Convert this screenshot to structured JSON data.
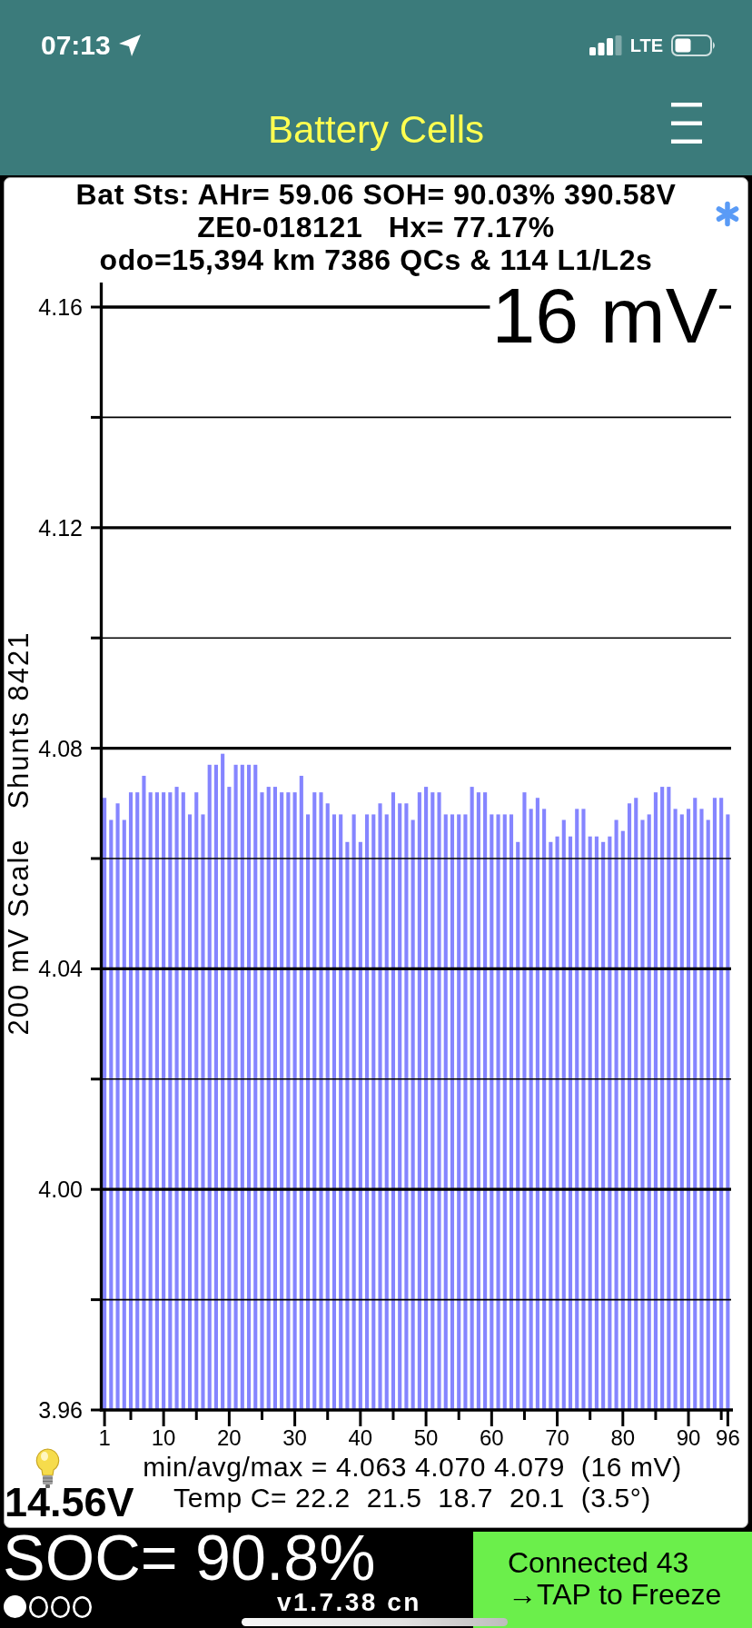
{
  "status_bar": {
    "time": "07:13",
    "network": "LTE"
  },
  "nav_bar": {
    "title": "Battery Cells"
  },
  "summary": {
    "lines": [
      "Bat Sts: AHr= 59.06 SOH= 90.03% 390.58V",
      "ZE0-018121   Hx= 77.17%",
      "odo=15,394 km 7386 QCs & 114 L1/L2s"
    ]
  },
  "cell_chart": {
    "spread": "16 mV",
    "chart_data": {
      "type": "bar",
      "ylabel": "200 mV Scale   Shunts 8421",
      "grid": true,
      "x": [
        1,
        2,
        3,
        4,
        5,
        6,
        7,
        8,
        9,
        10,
        11,
        12,
        13,
        14,
        15,
        16,
        17,
        18,
        19,
        20,
        21,
        22,
        23,
        24,
        25,
        26,
        27,
        28,
        29,
        30,
        31,
        32,
        33,
        34,
        35,
        36,
        37,
        38,
        39,
        40,
        41,
        42,
        43,
        44,
        45,
        46,
        47,
        48,
        49,
        50,
        51,
        52,
        53,
        54,
        55,
        56,
        57,
        58,
        59,
        60,
        61,
        62,
        63,
        64,
        65,
        66,
        67,
        68,
        69,
        70,
        71,
        72,
        73,
        74,
        75,
        76,
        77,
        78,
        79,
        80,
        81,
        82,
        83,
        84,
        85,
        86,
        87,
        88,
        89,
        90,
        91,
        92,
        93,
        94,
        95,
        96
      ],
      "values": [
        4.071,
        4.067,
        4.07,
        4.067,
        4.072,
        4.072,
        4.075,
        4.072,
        4.072,
        4.072,
        4.072,
        4.073,
        4.072,
        4.068,
        4.072,
        4.068,
        4.077,
        4.077,
        4.079,
        4.073,
        4.077,
        4.077,
        4.077,
        4.077,
        4.072,
        4.073,
        4.073,
        4.072,
        4.072,
        4.072,
        4.075,
        4.068,
        4.072,
        4.072,
        4.07,
        4.068,
        4.068,
        4.063,
        4.068,
        4.063,
        4.068,
        4.068,
        4.07,
        4.068,
        4.072,
        4.07,
        4.07,
        4.067,
        4.072,
        4.073,
        4.072,
        4.072,
        4.068,
        4.068,
        4.068,
        4.068,
        4.073,
        4.072,
        4.072,
        4.068,
        4.068,
        4.068,
        4.068,
        4.063,
        4.072,
        4.069,
        4.071,
        4.069,
        4.063,
        4.064,
        4.067,
        4.064,
        4.069,
        4.069,
        4.064,
        4.064,
        4.063,
        4.064,
        4.067,
        4.065,
        4.07,
        4.071,
        4.067,
        4.068,
        4.072,
        4.073,
        4.073,
        4.069,
        4.068,
        4.069,
        4.071,
        4.069,
        4.067,
        4.071,
        4.071,
        4.068
      ],
      "xlim": [
        0.5,
        96.5
      ],
      "ylim": [
        3.96,
        4.16
      ],
      "xticks": [
        1,
        10,
        20,
        30,
        40,
        50,
        60,
        70,
        80,
        90,
        96
      ],
      "yticks": [
        3.96,
        {
          "value": 4.0,
          "label": "4.00"
        },
        4.04,
        4.08,
        4.12,
        4.16
      ]
    }
  },
  "stats": {
    "min_avg_max": "min/avg/max = 4.063 4.070 4.079  (16 mV)",
    "temperatures": "Temp C= 22.2  21.5  18.7  20.1  (3.5°)",
    "aux_voltage": "14.56V"
  },
  "footer": {
    "soc": "SOC= 90.8%",
    "pager": [
      {
        "selected": true
      },
      {
        "selected": false
      },
      {
        "selected": false
      },
      {
        "selected": false
      }
    ],
    "version": "v1.7.38 cn",
    "connection_button": {
      "lines": [
        "Connected 43",
        "→TAP to Freeze"
      ]
    }
  }
}
